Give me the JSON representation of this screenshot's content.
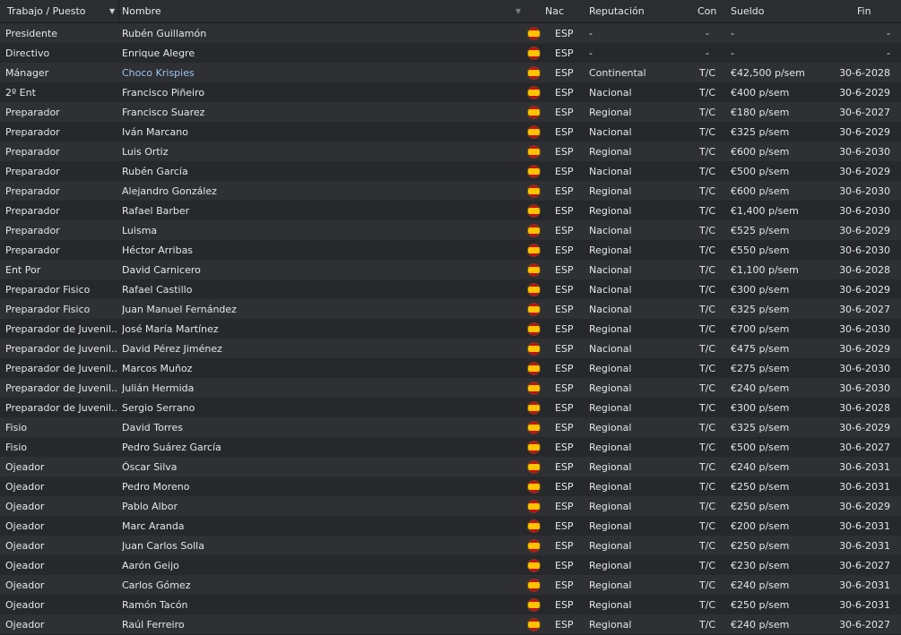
{
  "columns": {
    "job": "Trabajo / Puesto",
    "name": "Nombre",
    "nac": "Nac",
    "rep": "Reputación",
    "con": "Con",
    "salary": "Sueldo",
    "end": "Fin"
  },
  "rows": [
    {
      "job": "Presidente",
      "name": "Rubén Guillamón",
      "nac": "ESP",
      "rep": "-",
      "con": "-",
      "salary": "-",
      "end": "-",
      "flag": "spain-flag-icon"
    },
    {
      "job": "Directivo",
      "name": "Enrique Alegre",
      "nac": "ESP",
      "rep": "-",
      "con": "-",
      "salary": "-",
      "end": "-",
      "flag": "spain-flag-icon"
    },
    {
      "job": "Mánager",
      "name": "Choco Krispies",
      "nac": "ESP",
      "rep": "Continental",
      "con": "T/C",
      "salary": "€42,500 p/sem",
      "end": "30-6-2028",
      "flag": "spain-flag-icon",
      "highlight": "#9cc3ee"
    },
    {
      "job": "2º Ent",
      "name": "Francisco Piñeiro",
      "nac": "ESP",
      "rep": "Nacional",
      "con": "T/C",
      "salary": "€400 p/sem",
      "end": "30-6-2029",
      "flag": "spain-flag-icon"
    },
    {
      "job": "Preparador",
      "name": "Francisco Suarez",
      "nac": "ESP",
      "rep": "Regional",
      "con": "T/C",
      "salary": "€180 p/sem",
      "end": "30-6-2027",
      "flag": "spain-flag-icon"
    },
    {
      "job": "Preparador",
      "name": "Iván Marcano",
      "nac": "ESP",
      "rep": "Nacional",
      "con": "T/C",
      "salary": "€325 p/sem",
      "end": "30-6-2029",
      "flag": "spain-flag-icon"
    },
    {
      "job": "Preparador",
      "name": "Luis Ortiz",
      "nac": "ESP",
      "rep": "Regional",
      "con": "T/C",
      "salary": "€600 p/sem",
      "end": "30-6-2030",
      "flag": "spain-flag-icon"
    },
    {
      "job": "Preparador",
      "name": "Rubén García",
      "nac": "ESP",
      "rep": "Nacional",
      "con": "T/C",
      "salary": "€500 p/sem",
      "end": "30-6-2029",
      "flag": "spain-flag-icon"
    },
    {
      "job": "Preparador",
      "name": "Alejandro González",
      "nac": "ESP",
      "rep": "Regional",
      "con": "T/C",
      "salary": "€600 p/sem",
      "end": "30-6-2030",
      "flag": "spain-flag-icon"
    },
    {
      "job": "Preparador",
      "name": "Rafael Barber",
      "nac": "ESP",
      "rep": "Regional",
      "con": "T/C",
      "salary": "€1,400 p/sem",
      "end": "30-6-2030",
      "flag": "spain-flag-icon"
    },
    {
      "job": "Preparador",
      "name": "Luisma",
      "nac": "ESP",
      "rep": "Nacional",
      "con": "T/C",
      "salary": "€525 p/sem",
      "end": "30-6-2029",
      "flag": "spain-flag-icon"
    },
    {
      "job": "Preparador",
      "name": "Héctor Arribas",
      "nac": "ESP",
      "rep": "Regional",
      "con": "T/C",
      "salary": "€550 p/sem",
      "end": "30-6-2030",
      "flag": "spain-flag-icon"
    },
    {
      "job": "Ent Por",
      "name": "David Carnicero",
      "nac": "ESP",
      "rep": "Nacional",
      "con": "T/C",
      "salary": "€1,100 p/sem",
      "end": "30-6-2028",
      "flag": "spain-flag-icon"
    },
    {
      "job": "Preparador Fisico",
      "name": "Rafael Castillo",
      "nac": "ESP",
      "rep": "Nacional",
      "con": "T/C",
      "salary": "€300 p/sem",
      "end": "30-6-2029",
      "flag": "spain-flag-icon"
    },
    {
      "job": "Preparador Fisico",
      "name": "Juan Manuel Fernández",
      "nac": "ESP",
      "rep": "Nacional",
      "con": "T/C",
      "salary": "€325 p/sem",
      "end": "30-6-2027",
      "flag": "spain-flag-icon"
    },
    {
      "job": "Preparador de Juvenil..",
      "name": "José María Martínez",
      "nac": "ESP",
      "rep": "Regional",
      "con": "T/C",
      "salary": "€700 p/sem",
      "end": "30-6-2030",
      "flag": "spain-flag-icon"
    },
    {
      "job": "Preparador de Juvenil..",
      "name": "David Pérez Jiménez",
      "nac": "ESP",
      "rep": "Nacional",
      "con": "T/C",
      "salary": "€475 p/sem",
      "end": "30-6-2029",
      "flag": "spain-flag-icon"
    },
    {
      "job": "Preparador de Juvenil..",
      "name": "Marcos Muñoz",
      "nac": "ESP",
      "rep": "Regional",
      "con": "T/C",
      "salary": "€275 p/sem",
      "end": "30-6-2030",
      "flag": "spain-flag-icon"
    },
    {
      "job": "Preparador de Juvenil..",
      "name": "Julián Hermida",
      "nac": "ESP",
      "rep": "Regional",
      "con": "T/C",
      "salary": "€240 p/sem",
      "end": "30-6-2030",
      "flag": "spain-flag-icon"
    },
    {
      "job": "Preparador de Juvenil..",
      "name": "Sergio Serrano",
      "nac": "ESP",
      "rep": "Regional",
      "con": "T/C",
      "salary": "€300 p/sem",
      "end": "30-6-2028",
      "flag": "spain-flag-icon"
    },
    {
      "job": "Fisio",
      "name": "David Torres",
      "nac": "ESP",
      "rep": "Regional",
      "con": "T/C",
      "salary": "€325 p/sem",
      "end": "30-6-2029",
      "flag": "spain-flag-icon"
    },
    {
      "job": "Fisio",
      "name": "Pedro Suárez García",
      "nac": "ESP",
      "rep": "Regional",
      "con": "T/C",
      "salary": "€500 p/sem",
      "end": "30-6-2027",
      "flag": "spain-flag-icon"
    },
    {
      "job": "Ojeador",
      "name": "Óscar Silva",
      "nac": "ESP",
      "rep": "Regional",
      "con": "T/C",
      "salary": "€240 p/sem",
      "end": "30-6-2031",
      "flag": "spain-flag-icon"
    },
    {
      "job": "Ojeador",
      "name": "Pedro Moreno",
      "nac": "ESP",
      "rep": "Regional",
      "con": "T/C",
      "salary": "€250 p/sem",
      "end": "30-6-2031",
      "flag": "spain-flag-icon"
    },
    {
      "job": "Ojeador",
      "name": "Pablo Albor",
      "nac": "ESP",
      "rep": "Regional",
      "con": "T/C",
      "salary": "€250 p/sem",
      "end": "30-6-2029",
      "flag": "spain-flag-icon"
    },
    {
      "job": "Ojeador",
      "name": "Marc Aranda",
      "nac": "ESP",
      "rep": "Regional",
      "con": "T/C",
      "salary": "€200 p/sem",
      "end": "30-6-2031",
      "flag": "spain-flag-icon"
    },
    {
      "job": "Ojeador",
      "name": "Juan Carlos Solla",
      "nac": "ESP",
      "rep": "Regional",
      "con": "T/C",
      "salary": "€250 p/sem",
      "end": "30-6-2031",
      "flag": "spain-flag-icon"
    },
    {
      "job": "Ojeador",
      "name": "Aarón Geijo",
      "nac": "ESP",
      "rep": "Regional",
      "con": "T/C",
      "salary": "€230 p/sem",
      "end": "30-6-2027",
      "flag": "spain-flag-icon"
    },
    {
      "job": "Ojeador",
      "name": "Carlos Gómez",
      "nac": "ESP",
      "rep": "Regional",
      "con": "T/C",
      "salary": "€240 p/sem",
      "end": "30-6-2031",
      "flag": "spain-flag-icon"
    },
    {
      "job": "Ojeador",
      "name": "Ramón Tacón",
      "nac": "ESP",
      "rep": "Regional",
      "con": "T/C",
      "salary": "€250 p/sem",
      "end": "30-6-2031",
      "flag": "spain-flag-icon"
    },
    {
      "job": "Ojeador",
      "name": "Raúl Ferreiro",
      "nac": "ESP",
      "rep": "Regional",
      "con": "T/C",
      "salary": "€240 p/sem",
      "end": "30-6-2027",
      "flag": "spain-flag-icon"
    }
  ]
}
